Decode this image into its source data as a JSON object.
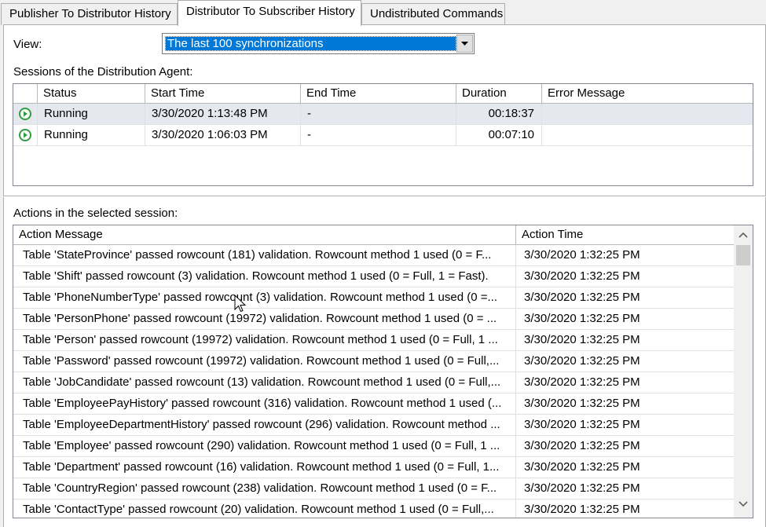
{
  "tabs": [
    {
      "label": "Publisher To Distributor History",
      "active": false
    },
    {
      "label": "Distributor To Subscriber History",
      "active": true
    },
    {
      "label": "Undistributed Commands",
      "active": false
    }
  ],
  "view": {
    "label": "View:",
    "selected": "The last 100 synchronizations"
  },
  "sessions": {
    "label": "Sessions of the Distribution Agent:",
    "columns": [
      "Status",
      "Start Time",
      "End Time",
      "Duration",
      "Error Message"
    ],
    "rows": [
      {
        "icon": "running-icon",
        "status": "Running",
        "start": "3/30/2020 1:13:48 PM",
        "end": "-",
        "duration": "00:18:37",
        "error": ""
      },
      {
        "icon": "running-icon",
        "status": "Running",
        "start": "3/30/2020 1:06:03 PM",
        "end": "-",
        "duration": "00:07:10",
        "error": ""
      }
    ]
  },
  "actions": {
    "label": "Actions in the selected session:",
    "columns": [
      "Action Message",
      "Action Time"
    ],
    "rows": [
      {
        "message": "Table 'StateProvince' passed rowcount (181) validation. Rowcount method 1 used (0 = F...",
        "time": "3/30/2020 1:32:25 PM"
      },
      {
        "message": "Table 'Shift' passed rowcount (3) validation. Rowcount method 1 used (0 = Full, 1 = Fast).",
        "time": "3/30/2020 1:32:25 PM"
      },
      {
        "message": "Table 'PhoneNumberType' passed rowcount (3) validation. Rowcount method 1 used (0 =...",
        "time": "3/30/2020 1:32:25 PM"
      },
      {
        "message": "Table 'PersonPhone' passed rowcount (19972) validation. Rowcount method 1 used (0 = ...",
        "time": "3/30/2020 1:32:25 PM"
      },
      {
        "message": "Table 'Person' passed rowcount (19972) validation. Rowcount method 1 used (0 = Full, 1 ...",
        "time": "3/30/2020 1:32:25 PM"
      },
      {
        "message": "Table 'Password' passed rowcount (19972) validation. Rowcount method 1 used (0 = Full,...",
        "time": "3/30/2020 1:32:25 PM"
      },
      {
        "message": "Table 'JobCandidate' passed rowcount (13) validation. Rowcount method 1 used (0 = Full,...",
        "time": "3/30/2020 1:32:25 PM"
      },
      {
        "message": "Table 'EmployeePayHistory' passed rowcount (316) validation. Rowcount method 1 used (...",
        "time": "3/30/2020 1:32:25 PM"
      },
      {
        "message": "Table 'EmployeeDepartmentHistory' passed rowcount (296) validation. Rowcount method ...",
        "time": "3/30/2020 1:32:25 PM"
      },
      {
        "message": "Table 'Employee' passed rowcount (290) validation. Rowcount method 1 used (0 = Full, 1 ...",
        "time": "3/30/2020 1:32:25 PM"
      },
      {
        "message": "Table 'Department' passed rowcount (16) validation. Rowcount method 1 used (0 = Full, 1...",
        "time": "3/30/2020 1:32:25 PM"
      },
      {
        "message": "Table 'CountryRegion' passed rowcount (238) validation. Rowcount method 1 used (0 = F...",
        "time": "3/30/2020 1:32:25 PM"
      },
      {
        "message": "Table 'ContactType' passed rowcount (20) validation. Rowcount method 1 used (0 = Full,...",
        "time": "3/30/2020 1:32:25 PM"
      }
    ]
  },
  "colors": {
    "selection": "#0078d7",
    "running_icon": "#2e9e3e",
    "selected_row": "#e5e8ef"
  }
}
